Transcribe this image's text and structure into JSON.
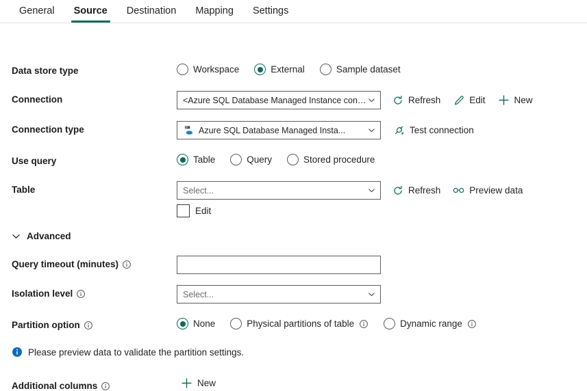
{
  "tabs": [
    {
      "label": "General",
      "active": false
    },
    {
      "label": "Source",
      "active": true
    },
    {
      "label": "Destination",
      "active": false
    },
    {
      "label": "Mapping",
      "active": false
    },
    {
      "label": "Settings",
      "active": false
    }
  ],
  "colors": {
    "accent_teal": "#0f6b5c",
    "radio_selected": "#0b6a5c",
    "info_blue": "#0f6cbd",
    "border_gray": "#605e5c",
    "text_primary": "#242424"
  },
  "data_store_type": {
    "label": "Data store type",
    "options": [
      "Workspace",
      "External",
      "Sample dataset"
    ],
    "selected": "External"
  },
  "connection": {
    "label": "Connection",
    "value": "<Azure SQL Database Managed Instance connection>",
    "commands": [
      {
        "label": "Refresh",
        "icon": "refresh-icon"
      },
      {
        "label": "Edit",
        "icon": "pencil-icon"
      },
      {
        "label": "New",
        "icon": "plus-icon"
      }
    ]
  },
  "connection_type": {
    "label": "Connection type",
    "value": "Azure SQL Database Managed Insta...",
    "icon": "sql-database-icon",
    "commands": [
      {
        "label": "Test connection",
        "icon": "plug-icon"
      }
    ]
  },
  "use_query": {
    "label": "Use query",
    "options": [
      "Table",
      "Query",
      "Stored procedure"
    ],
    "selected": "Table"
  },
  "table": {
    "label": "Table",
    "placeholder": "Select...",
    "value": "",
    "commands": [
      {
        "label": "Refresh",
        "icon": "refresh-icon"
      },
      {
        "label": "Preview data",
        "icon": "glasses-icon"
      }
    ],
    "edit_checkbox": {
      "label": "Edit",
      "checked": false
    }
  },
  "advanced": {
    "label": "Advanced",
    "expanded": true
  },
  "query_timeout": {
    "label": "Query timeout (minutes)",
    "has_info": true,
    "value": "",
    "placeholder": ""
  },
  "isolation_level": {
    "label": "Isolation level",
    "has_info": true,
    "placeholder": "Select...",
    "value": ""
  },
  "partition_option": {
    "label": "Partition option",
    "has_info": true,
    "selected": "None",
    "options": [
      {
        "label": "None",
        "has_info": false
      },
      {
        "label": "Physical partitions of table",
        "has_info": true
      },
      {
        "label": "Dynamic range",
        "has_info": true
      }
    ]
  },
  "message": {
    "icon": "info-filled-icon",
    "text": "Please preview data to validate the partition settings."
  },
  "additional_columns": {
    "label": "Additional columns",
    "has_info": true,
    "new_button": {
      "label": "New",
      "icon": "plus-icon"
    }
  }
}
